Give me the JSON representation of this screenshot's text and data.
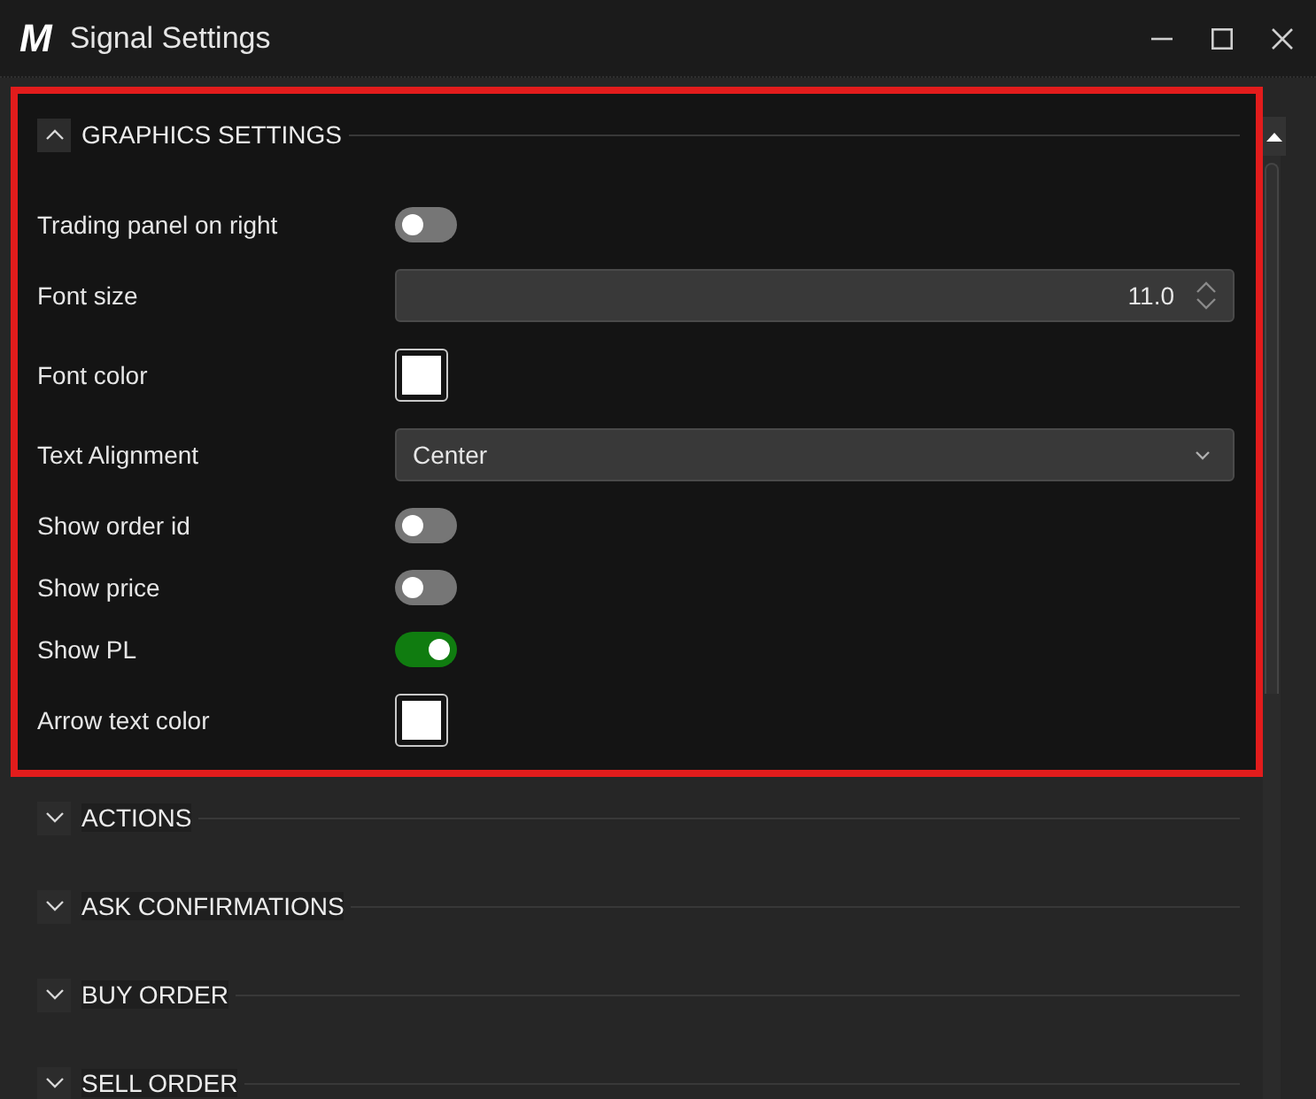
{
  "window": {
    "logo": "M",
    "title": "Signal Settings"
  },
  "sections": [
    {
      "title": "GRAPHICS SETTINGS",
      "expanded": true,
      "highlighted": true,
      "rows": [
        {
          "kind": "toggle",
          "label": "Trading panel on right",
          "on": false
        },
        {
          "kind": "spinner",
          "label": "Font size",
          "value": "11.0"
        },
        {
          "kind": "color",
          "label": "Font color",
          "color": "#ffffff"
        },
        {
          "kind": "dropdown",
          "label": "Text Alignment",
          "value": "Center"
        },
        {
          "kind": "toggle",
          "label": "Show order id",
          "on": false
        },
        {
          "kind": "toggle",
          "label": "Show price",
          "on": false
        },
        {
          "kind": "toggle",
          "label": "Show PL",
          "on": true
        },
        {
          "kind": "color",
          "label": "Arrow text color",
          "color": "#ffffff"
        }
      ]
    },
    {
      "title": "ACTIONS",
      "expanded": false,
      "highlighted": false
    },
    {
      "title": "ASK CONFIRMATIONS",
      "expanded": false,
      "highlighted": false
    },
    {
      "title": "BUY ORDER",
      "expanded": false,
      "highlighted": false
    },
    {
      "title": "SELL ORDER",
      "expanded": false,
      "highlighted": false
    }
  ]
}
